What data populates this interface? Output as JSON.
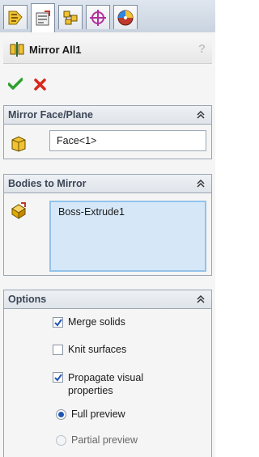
{
  "tabs": [
    {
      "name": "feature-manager",
      "icon": "feature-tree-icon",
      "active": false
    },
    {
      "name": "property-manager",
      "icon": "property-manager-icon",
      "active": true
    },
    {
      "name": "configuration-manager",
      "icon": "configuration-icon",
      "active": false
    },
    {
      "name": "dimxpert-manager",
      "icon": "dimxpert-icon",
      "active": false
    },
    {
      "name": "display-manager",
      "icon": "display-manager-icon",
      "active": false
    }
  ],
  "feature": {
    "title": "Mirror All1",
    "help": "?"
  },
  "actions": {
    "ok_icon": "green-check-icon",
    "cancel_icon": "red-x-icon"
  },
  "mirror_face": {
    "header": "Mirror Face/Plane",
    "value": "Face<1>"
  },
  "bodies": {
    "header": "Bodies to Mirror",
    "items": [
      "Boss-Extrude1"
    ]
  },
  "options": {
    "header": "Options",
    "merge_solids": {
      "label": "Merge solids",
      "checked": true
    },
    "knit_surfaces": {
      "label": "Knit surfaces",
      "checked": false
    },
    "propagate_line1": "Propagate visual",
    "propagate_line2": "properties",
    "propagate_checked": true,
    "full_preview": {
      "label": "Full preview",
      "selected": true
    },
    "partial_preview": {
      "label": "Partial preview",
      "selected": false
    }
  },
  "colors": {
    "accent_blue": "#1f55b8",
    "list_selection": "#d6e8f8",
    "header_text": "#3c4656"
  }
}
